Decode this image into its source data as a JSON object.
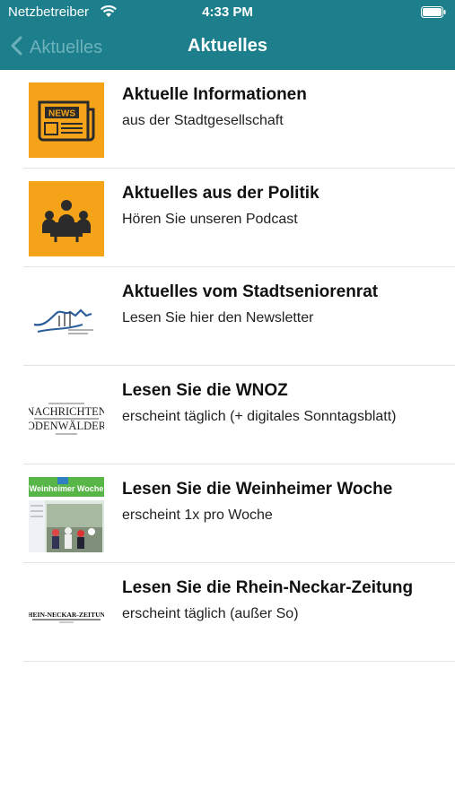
{
  "status_bar": {
    "carrier": "Netzbetreiber",
    "time": "4:33 PM"
  },
  "nav": {
    "back_label": "Aktuelles",
    "title": "Aktuelles"
  },
  "colors": {
    "nav_background": "#1d7f8c",
    "icon_orange": "#f5a419"
  },
  "items": [
    {
      "title": "Aktuelle Informationen",
      "subtitle": "aus der Stadtgesellschaft",
      "icon": "newspaper-icon"
    },
    {
      "title": "Aktuelles aus der Politik",
      "subtitle": "Hören Sie unseren Podcast",
      "icon": "meeting-icon"
    },
    {
      "title": "Aktuelles vom Stadtseniorenrat",
      "subtitle": "Lesen Sie hier den Newsletter",
      "icon": "stadtseniorenrat-logo"
    },
    {
      "title": "Lesen Sie die WNOZ",
      "subtitle": "erscheint täglich (+ digitales Sonntagsblatt)",
      "icon": "wnoz-logo"
    },
    {
      "title": "Lesen Sie die Weinheimer Woche",
      "subtitle": "erscheint 1x pro Woche",
      "icon": "weinheimer-woche-cover"
    },
    {
      "title": "Lesen Sie die Rhein-Neckar-Zeitung",
      "subtitle": "erscheint täglich (außer So)",
      "icon": "rnz-logo"
    }
  ],
  "logos": {
    "newspaper_word": "NEWS",
    "wnoz_line1": "NACHRICHTEN",
    "wnoz_line2": "ODENWÄLDER",
    "weinheimer_woche": "Weinheimer Woche",
    "rnz": "RHEIN-NECKAR-ZEITUNG"
  }
}
